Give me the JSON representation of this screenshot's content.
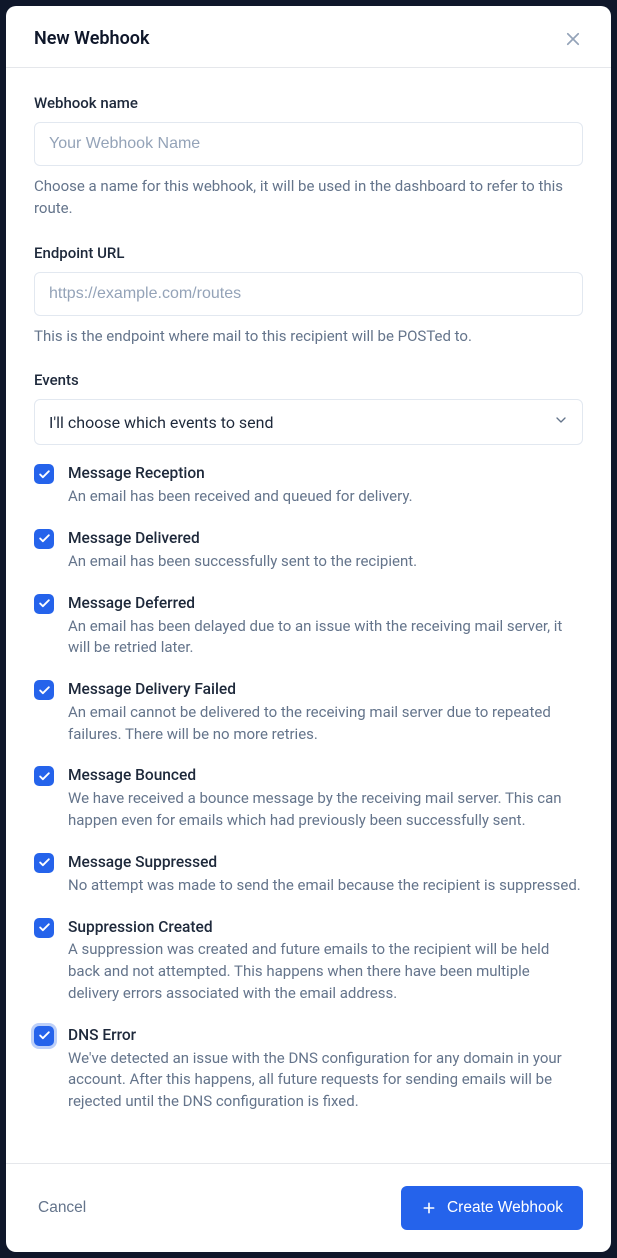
{
  "modal": {
    "title": "New Webhook"
  },
  "fields": {
    "name": {
      "label": "Webhook name",
      "placeholder": "Your Webhook Name",
      "helper": "Choose a name for this webhook, it will be used in the dashboard to refer to this route."
    },
    "endpoint": {
      "label": "Endpoint URL",
      "placeholder": "https://example.com/routes",
      "helper": "This is the endpoint where mail to this recipient will be POSTed to."
    },
    "events": {
      "label": "Events",
      "select_value": "I'll choose which events to send"
    }
  },
  "events": [
    {
      "title": "Message Reception",
      "desc": "An email has been received and queued for delivery.",
      "checked": true
    },
    {
      "title": "Message Delivered",
      "desc": "An email has been successfully sent to the recipient.",
      "checked": true
    },
    {
      "title": "Message Deferred",
      "desc": "An email has been delayed due to an issue with the receiving mail server, it will be retried later.",
      "checked": true
    },
    {
      "title": "Message Delivery Failed",
      "desc": "An email cannot be delivered to the receiving mail server due to repeated failures. There will be no more retries.",
      "checked": true
    },
    {
      "title": "Message Bounced",
      "desc": "We have received a bounce message by the receiving mail server. This can happen even for emails which had previously been successfully sent.",
      "checked": true
    },
    {
      "title": "Message Suppressed",
      "desc": "No attempt was made to send the email because the recipient is suppressed.",
      "checked": true
    },
    {
      "title": "Suppression Created",
      "desc": "A suppression was created and future emails to the recipient will be held back and not attempted. This happens when there have been multiple delivery errors associated with the email address.",
      "checked": true
    },
    {
      "title": "DNS Error",
      "desc": "We've detected an issue with the DNS configuration for any domain in your account. After this happens, all future requests for sending emails will be rejected until the DNS configuration is fixed.",
      "checked": true,
      "focused": true
    }
  ],
  "footer": {
    "cancel": "Cancel",
    "submit": "Create Webhook"
  }
}
